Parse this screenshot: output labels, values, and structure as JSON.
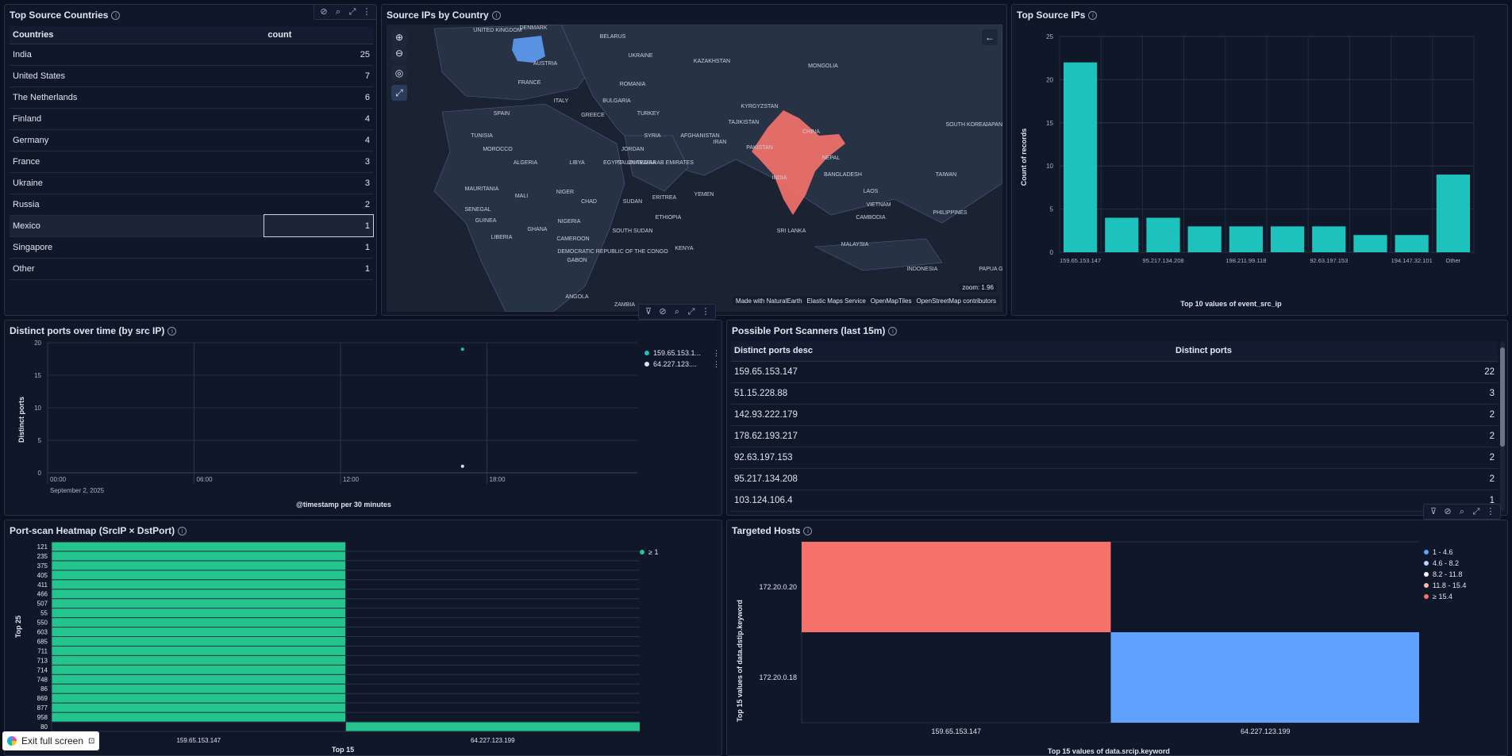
{
  "top_countries": {
    "title": "Top Source Countries",
    "col_country": "Countries",
    "col_count": "count",
    "rows": [
      {
        "country": "India",
        "count": "25"
      },
      {
        "country": "United States",
        "count": "7"
      },
      {
        "country": "The Netherlands",
        "count": "6"
      },
      {
        "country": "Finland",
        "count": "4"
      },
      {
        "country": "Germany",
        "count": "4"
      },
      {
        "country": "France",
        "count": "3"
      },
      {
        "country": "Ukraine",
        "count": "3"
      },
      {
        "country": "Russia",
        "count": "2"
      },
      {
        "country": "Mexico",
        "count": "1"
      },
      {
        "country": "Singapore",
        "count": "1"
      },
      {
        "country": "Other",
        "count": "1"
      }
    ]
  },
  "map": {
    "title": "Source IPs by Country",
    "zoom": "zoom: 1.96",
    "attribution": [
      "Made with NaturalEarth",
      "Elastic Maps Service",
      "OpenMapTiles",
      "OpenStreetMap contributors"
    ],
    "labels": [
      "UNITED KINGDOM",
      "DENMARK",
      "BELARUS",
      "UKRAINE",
      "FRANCE",
      "AUSTRIA",
      "ROMANIA",
      "KAZAKHSTAN",
      "MONGOLIA",
      "ITALY",
      "BULGARIA",
      "SPAIN",
      "GREECE",
      "TURKEY",
      "KYRGYZSTAN",
      "TAJIKISTAN",
      "CHINA",
      "SOUTH KOREA",
      "JAPAN",
      "TUNISIA",
      "SYRIA",
      "AFGHANISTAN",
      "MOROCCO",
      "JORDAN",
      "IRAN",
      "PAKISTAN",
      "NEPAL",
      "ALGERIA",
      "LIBYA",
      "EGYPT",
      "SAUDI ARABIA",
      "UNITED ARAB EMIRATES",
      "INDIA",
      "BANGLADESH",
      "TAIWAN",
      "MAURITANIA",
      "MALI",
      "NIGER",
      "LAOS",
      "SENEGAL",
      "CHAD",
      "SUDAN",
      "ERITREA",
      "YEMEN",
      "VIETNAM",
      "PHILIPPINES",
      "GUINEA",
      "NIGERIA",
      "ETHIOPIA",
      "CAMBODIA",
      "LIBERIA",
      "GHANA",
      "SOUTH SUDAN",
      "SRI LANKA",
      "MALAYSIA",
      "CAMEROON",
      "GABON",
      "DEMOCRATIC REPUBLIC OF THE CONGO",
      "KENYA",
      "INDONESIA",
      "PAPUA GUI",
      "ANGOLA",
      "ZAMBIA"
    ]
  },
  "top_ips": {
    "title": "Top Source IPs",
    "xlabel": "Top 10 values of event_src_ip",
    "ylabel": "Count of records",
    "tick_labels": [
      "159.65.153.147",
      "95.217.134.208",
      "198.211.99.118",
      "92.63.197.153",
      "194.147.32.101",
      "Other"
    ]
  },
  "ports_time": {
    "title": "Distinct ports over time (by src IP)",
    "xlabel": "@timestamp per 30 minutes",
    "ylabel": "Distinct ports",
    "date_label": "September 2, 2025",
    "legend": [
      "159.65.153.1...",
      "64.227.123...."
    ]
  },
  "scanners": {
    "title": "Possible Port Scanners (last 15m)",
    "col_ip": "Distinct ports desc",
    "col_ports": "Distinct ports",
    "rows": [
      {
        "ip": "159.65.153.147",
        "ports": "22"
      },
      {
        "ip": "51.15.228.88",
        "ports": "3"
      },
      {
        "ip": "142.93.222.179",
        "ports": "2"
      },
      {
        "ip": "178.62.193.217",
        "ports": "2"
      },
      {
        "ip": "92.63.197.153",
        "ports": "2"
      },
      {
        "ip": "95.217.134.208",
        "ports": "2"
      },
      {
        "ip": "103.124.106.4",
        "ports": "1"
      }
    ]
  },
  "heatmap": {
    "title": "Port-scan Heatmap (SrcIP × DstPort)",
    "ylabel": "Top 25",
    "xlabel": "Top 15",
    "legend": "≥ 1",
    "x_labels": [
      "159.65.153.147",
      "64.227.123.199"
    ]
  },
  "targeted": {
    "title": "Targeted Hosts",
    "ylabel": "Top 15 values of data.dstip.keyword",
    "xlabel": "Top 15 values of data.srcip.keyword",
    "legend": [
      "1 - 4.6",
      "4.6 - 8.2",
      "8.2 - 11.8",
      "11.8 - 15.4",
      "≥ 15.4"
    ]
  },
  "exit_full_screen": "Exit full screen",
  "colors": {
    "teal": "#1ec2bd",
    "green": "#24c48f",
    "red": "#f6726a",
    "blue": "#61a2ff"
  },
  "chart_data": [
    {
      "type": "bar",
      "title": "Top Source IPs",
      "xlabel": "Top 10 values of event_src_ip",
      "ylabel": "Count of records",
      "ylim": [
        0,
        25
      ],
      "yticks": [
        0,
        5,
        10,
        15,
        20,
        25
      ],
      "categories": [
        "159.65.153.147",
        "",
        "95.217.134.208",
        "",
        "198.211.99.118",
        "",
        "92.63.197.153",
        "",
        "194.147.32.101",
        "Other"
      ],
      "values": [
        22,
        4,
        4,
        3,
        3,
        3,
        3,
        2,
        2,
        9
      ]
    },
    {
      "type": "scatter",
      "title": "Distinct ports over time (by src IP)",
      "xlabel": "@timestamp per 30 minutes",
      "ylabel": "Distinct ports",
      "ylim": [
        0,
        20
      ],
      "yticks": [
        0,
        5,
        10,
        15,
        20
      ],
      "xticks": [
        "00:00",
        "06:00",
        "12:00",
        "18:00"
      ],
      "series": [
        {
          "name": "159.65.153.1...",
          "points": [
            {
              "t": "17:00",
              "y": 19
            }
          ]
        },
        {
          "name": "64.227.123....",
          "points": [
            {
              "t": "17:00",
              "y": 1
            }
          ]
        }
      ]
    },
    {
      "type": "heatmap",
      "title": "Port-scan Heatmap (SrcIP × DstPort)",
      "rows": [
        "121",
        "235",
        "375",
        "405",
        "411",
        "466",
        "507",
        "55",
        "550",
        "603",
        "685",
        "711",
        "713",
        "714",
        "748",
        "86",
        "869",
        "877",
        "958",
        "80"
      ],
      "columns": [
        "159.65.153.147",
        "64.227.123.199"
      ],
      "filled": [
        [
          1,
          0
        ],
        [
          1,
          0
        ],
        [
          1,
          0
        ],
        [
          1,
          0
        ],
        [
          1,
          0
        ],
        [
          1,
          0
        ],
        [
          1,
          0
        ],
        [
          1,
          0
        ],
        [
          1,
          0
        ],
        [
          1,
          0
        ],
        [
          1,
          0
        ],
        [
          1,
          0
        ],
        [
          1,
          0
        ],
        [
          1,
          0
        ],
        [
          1,
          0
        ],
        [
          1,
          0
        ],
        [
          1,
          0
        ],
        [
          1,
          0
        ],
        [
          1,
          0
        ],
        [
          0,
          1
        ]
      ]
    },
    {
      "type": "heatmap",
      "title": "Targeted Hosts",
      "rows": [
        "172.20.0.20",
        "172.20.0.18"
      ],
      "columns": [
        "159.65.153.147",
        "64.227.123.199"
      ],
      "cells": [
        [
          "≥ 15.4",
          ""
        ],
        [
          "",
          "1 - 4.6"
        ]
      ]
    }
  ]
}
